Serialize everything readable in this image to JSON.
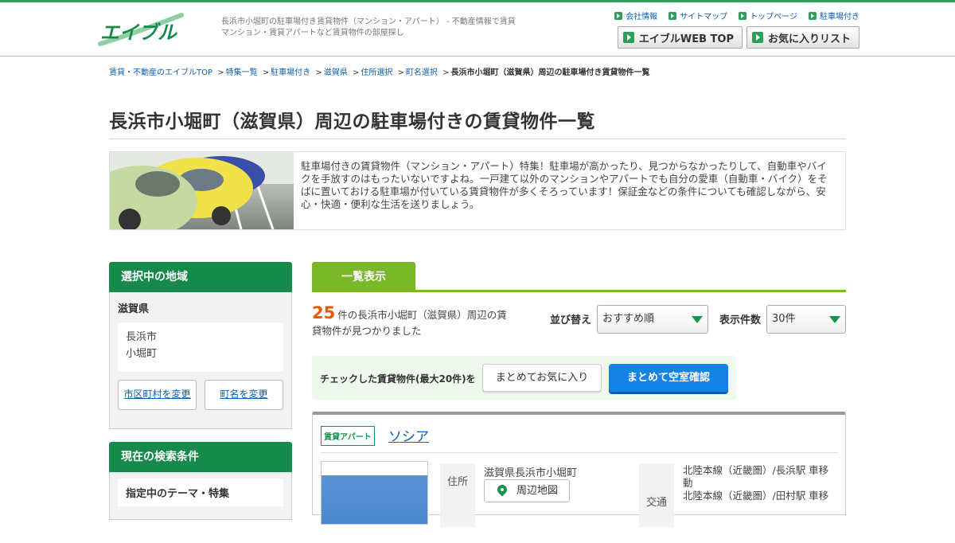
{
  "header": {
    "logo_text": "エイブル",
    "tagline": "長浜市小堀町の駐車場付き賃貸物件（マンション・アパート） - 不動産情報で賃貸マンション・賃貸アパートなど賃貸物件の部屋探し",
    "links": [
      "会社情報",
      "サイトマップ",
      "トップページ",
      "駐車場付き"
    ],
    "buttons": [
      "エイブルWEB TOP",
      "お気に入りリスト"
    ],
    "accent": "#2e9e5b"
  },
  "breadcrumb": {
    "items": [
      "賃貸・不動産のエイブルTOP",
      "特集一覧",
      "駐車場付き",
      "滋賀県",
      "住所選択",
      "町名選択"
    ],
    "current": "長浜市小堀町（滋賀県）周辺の駐車場付き賃貸物件一覧",
    "separator": ">"
  },
  "page_title": "長浜市小堀町（滋賀県）周辺の駐車場付きの賃貸物件一覧",
  "intro": "駐車場付きの賃貸物件（マンション・アパート）特集！駐車場が高かったり、見つからなかったりして、自動車やバイクを手放すのはもったいないですよね。一戸建て以外のマンションやアパートでも自分の愛車（自動車・バイク）をそばに置いておける駐車場が付いている賃貸物件が多くそろっています！保証金などの条件についても確認しながら、安心・快適・便利な生活を送りましょう。",
  "sidebar": {
    "region_heading": "選択中の地域",
    "prefecture": "滋賀県",
    "city": "長浜市",
    "town": "小堀町",
    "change_city": "市区町村を変更",
    "change_town": "町名を変更",
    "conditions_heading": "現在の検索条件",
    "theme_label": "指定中のテーマ・特集"
  },
  "main": {
    "tab_label": "一覧表示",
    "count": "25",
    "count_text": "件の長浜市小堀町（滋賀県）周辺の賃貸物件が見つかりました",
    "sort_label": "並び替え",
    "sort_value": "おすすめ順",
    "per_page_label": "表示件数",
    "per_page_value": "30件",
    "bulk_text": "チェックした賃貸物件(最大20件)を",
    "bulk_fav": "まとめてお気に入り",
    "bulk_check": "まとめて空室確認",
    "accent_green": "#7ab828",
    "accent_blue": "#1383e6"
  },
  "property": {
    "type": "賃貸アパート",
    "name": "ソシア",
    "address_label": "住所",
    "address": "滋賀県長浜市小堀町",
    "map_button": "周辺地図",
    "traffic_label": "交通",
    "traffic": [
      "北陸本線（近畿圏）/長浜駅 車移動",
      "北陸本線（近畿圏）/田村駅 車移"
    ]
  }
}
